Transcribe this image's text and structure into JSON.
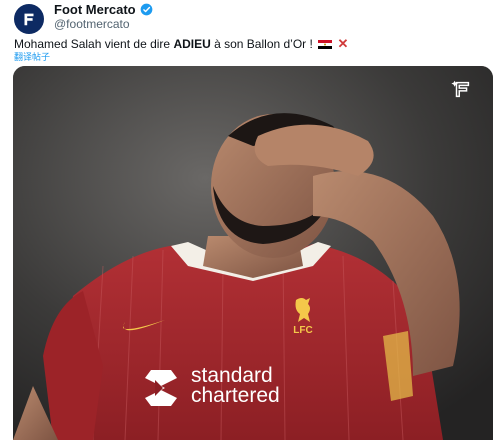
{
  "tweet": {
    "author_name": "Foot Mercato",
    "author_handle": "@footmercato",
    "text_before": "Mohamed Salah vient de dire ",
    "text_bold": "ADIEU",
    "text_after": " à son Ballon d’Or !",
    "translate_label": "翻译帖子"
  },
  "media": {
    "sponsor_line1": "standard",
    "sponsor_line2": "chartered",
    "club_initials": "LFC"
  },
  "icons": {
    "avatar": "foot-mercato-logo-icon",
    "verified": "verified-badge-icon",
    "media_logo": "foot-mercato-logo-icon",
    "flag": "egypt-flag-icon",
    "cross": "cross-mark-icon"
  },
  "colors": {
    "brand": "#0d2a63",
    "verified": "#1d9bf0",
    "link": "#1d9bf0",
    "jersey": "#a8262b"
  }
}
